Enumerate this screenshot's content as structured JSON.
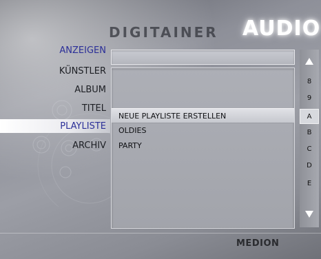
{
  "brand": {
    "name": "DIGITAINER",
    "section": "AUDIO",
    "maker": "MEDION"
  },
  "nav": {
    "items": [
      {
        "label": "ANZEIGEN"
      },
      {
        "label": "KÜNSTLER"
      },
      {
        "label": "ALBUM"
      },
      {
        "label": "TITEL"
      },
      {
        "label": "PLAYLISTE"
      },
      {
        "label": "ARCHIV"
      }
    ],
    "active_index": 4
  },
  "list": {
    "header_value": "",
    "items": [
      {
        "label": "NEUE PLAYLISTE ERSTELLEN",
        "selected": true
      },
      {
        "label": "OLDIES",
        "selected": false
      },
      {
        "label": "PARTY",
        "selected": false
      }
    ]
  },
  "alpha_index": {
    "keys": [
      "8",
      "9",
      "A",
      "B",
      "C",
      "D",
      "E"
    ],
    "selected": "A"
  },
  "colors": {
    "accent_blue": "#2b2f98",
    "title_glow": "#ffffff"
  }
}
